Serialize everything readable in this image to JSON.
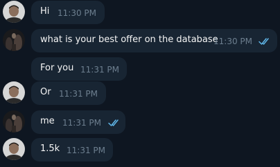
{
  "messages": [
    {
      "text": "Hi",
      "time": "11:30 PM",
      "status": "",
      "avatar": "man-photo"
    },
    {
      "text": "what is your best offer on the database",
      "time": "11:30 PM",
      "status": "read",
      "avatar": "dark-group-photo"
    },
    {
      "text": "For you",
      "time": "11:31 PM",
      "status": "",
      "avatar": ""
    },
    {
      "text": "Or",
      "time": "11:31 PM",
      "status": "",
      "avatar": "man-photo"
    },
    {
      "text": "me",
      "time": "11:31 PM",
      "status": "read",
      "avatar": "dark-group-photo"
    },
    {
      "text": "1.5k",
      "time": "11:31 PM",
      "status": "",
      "avatar": "man-photo"
    }
  ],
  "colors": {
    "background": "#0e1621",
    "bubble": "#182533",
    "text": "#f5f5f5",
    "time": "#6d7f8f",
    "read_check": "#5fb5e7"
  }
}
